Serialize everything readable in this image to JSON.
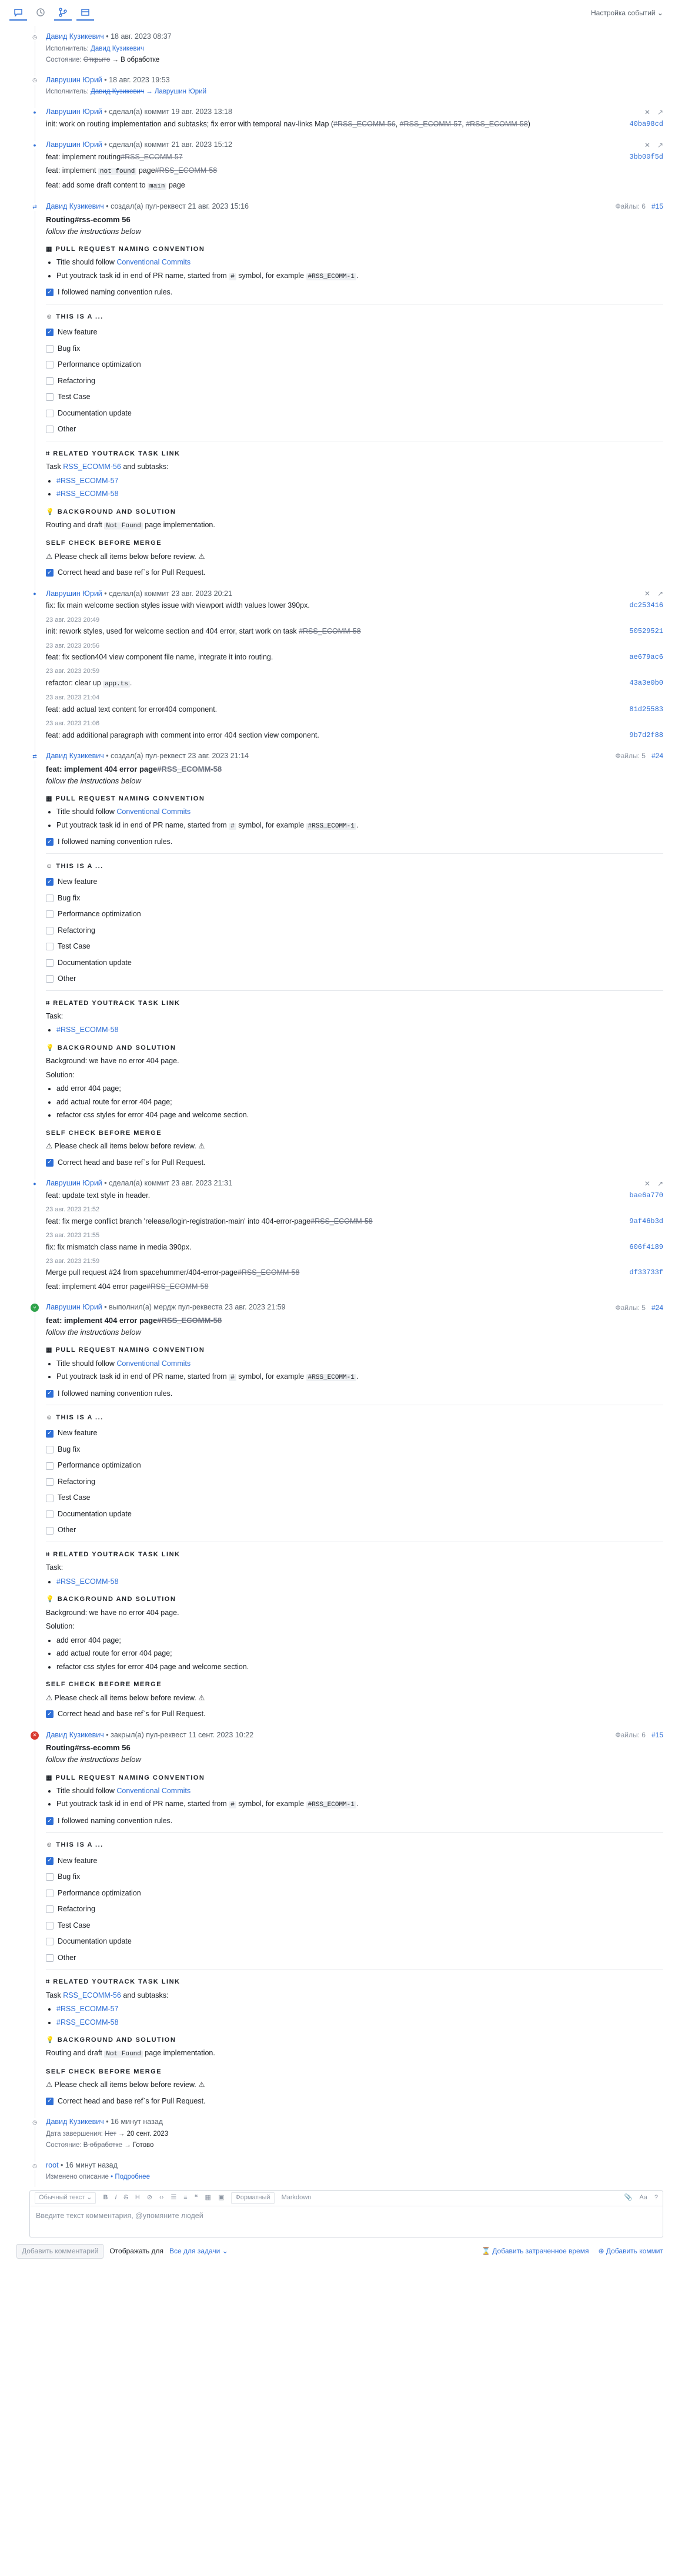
{
  "toolbar": {
    "settings": "Настройка событий ⌄"
  },
  "e1": {
    "author": "Давид Кузикевич",
    "date": "• 18 авг. 2023 08:37",
    "assignee_label": "Исполнитель:",
    "assignee": "Давид Кузикевич",
    "state_label": "Состояние:",
    "state_old": "Открыто",
    "state_new": "→ В обработке"
  },
  "e2": {
    "author": "Лаврушин Юрий",
    "date": "• 18 авг. 2023 19:53",
    "assignee_label": "Исполнитель:",
    "assignee_old": "Давид Кузикевич",
    "assignee_new": "→ Лаврушин Юрий"
  },
  "e3": {
    "author": "Лаврушин Юрий",
    "action": "• сделал(а) коммит 19 авг. 2023 13:18",
    "msg": "init: work on routing implementation and subtasks; fix error with temporal nav-links Map (",
    "s1": "#RSS_ECOMM-56",
    "s2": "#RSS_ECOMM-57",
    "s3": "#RSS_ECOMM-58",
    "end": ")",
    "hash": "40ba98cd"
  },
  "e4": {
    "author": "Лаврушин Юрий",
    "action": "• сделал(а) коммит 21 авг. 2023 15:12",
    "l1": "feat: implement routing",
    "l1s": "#RSS_ECOMM-57",
    "l2a": "feat: implement",
    "l2c": "not found",
    "l2b": "page",
    "l2s": "#RSS_ECOMM-58",
    "l3a": "feat: add some draft content to",
    "l3c": "main",
    "l3b": "page",
    "hash": "3bb00f5d"
  },
  "pr1": {
    "author": "Давид Кузикевич",
    "action": "• создал(а) пул-реквест 21 авг. 2023 15:16",
    "files": "Файлы: 6",
    "num": "#15",
    "title": "Routing#rss-ecomm 56",
    "sub": "follow the instructions below",
    "naming": "PULL REQUEST NAMING CONVENTION",
    "n1a": "Title should follow",
    "n1l": "Conventional Commits",
    "n2a": "Put youtrack task id in end of PR name, started from",
    "n2c": "#",
    "n2b": "symbol, for example",
    "n2c2": "#RSS_ECOMM-1",
    "n3": "I followed naming convention rules.",
    "this": "THIS IS A ...",
    "o": [
      "New feature",
      "Bug fix",
      "Performance optimization",
      "Refactoring",
      "Test Case",
      "Documentation update",
      "Other"
    ],
    "rel": "RELATED YOUTRACK TASK LINK",
    "task_a": "Task",
    "task_l": "RSS_ECOMM-56",
    "task_b": "and subtasks:",
    "sub1": "#RSS_ECOMM-57",
    "sub2": "#RSS_ECOMM-58",
    "bg": "BACKGROUND AND SOLUTION",
    "bg_a": "Routing and draft",
    "bg_c": "Not Found",
    "bg_b": "page implementation.",
    "self": "SELF CHECK BEFORE MERGE",
    "warn": "⚠ Please check all items below before review. ⚠",
    "sc1": "Correct head and base ref`s for Pull Request."
  },
  "e5": {
    "author": "Лаврушин Юрий",
    "action": "• сделал(а) коммит 23 авг. 2023 20:21",
    "c": [
      {
        "d": "",
        "m": "fix: fix main welcome section styles issue with viewport width values lower 390px.",
        "h": "dc253416"
      },
      {
        "d": "23 авг. 2023 20:49",
        "m": "init: rework styles, used for welcome section and 404 error, start work on task",
        "s": "#RSS_ECOMM-58",
        "h": "50529521"
      },
      {
        "d": "23 авг. 2023 20:56",
        "m": "feat: fix section404 view component file name, integrate it into routing.",
        "h": "ae679ac6"
      },
      {
        "d": "23 авг. 2023 20:59",
        "m": "refactor: clear up",
        "code": "app.ts",
        "h": "43a3e0b0"
      },
      {
        "d": "23 авг. 2023 21:04",
        "m": "feat: add actual text content for error404 component.",
        "h": "81d25583"
      },
      {
        "d": "23 авг. 2023 21:06",
        "m": "feat: add additional paragraph with comment into error 404 section view component.",
        "h": "9b7d2f88"
      }
    ]
  },
  "pr2": {
    "author": "Давид Кузикевич",
    "action": "• создал(а) пул-реквест 23 авг. 2023 21:14",
    "files": "Файлы: 5",
    "num": "#24",
    "title": "feat: implement 404 error page",
    "title_s": "#RSS_ECOMM-58",
    "sub": "follow the instructions below",
    "task": "Task:",
    "task_l": "#RSS_ECOMM-58",
    "bg1": "Background: we have no error 404 page.",
    "bg2": "Solution:",
    "bl": [
      "add error 404 page;",
      "add actual route for error 404 page;",
      "refactor css styles for error 404 page and welcome section."
    ]
  },
  "e6": {
    "author": "Лаврушин Юрий",
    "action": "• сделал(а) коммит 23 авг. 2023 21:31",
    "c": [
      {
        "d": "",
        "m": "feat: update text style in header.",
        "h": "bae6a770"
      },
      {
        "d": "23 авг. 2023 21:52",
        "m": "feat: fix merge conflict branch 'release/login-registration-main' into 404-error-page",
        "s": "#RSS_ECOMM-58",
        "h": "9af46b3d"
      },
      {
        "d": "23 авг. 2023 21:55",
        "m": "fix: fix mismatch class name in media 390px.",
        "h": "606f4189"
      },
      {
        "d": "23 авг. 2023 21:59",
        "m": "Merge pull request #24 from spacehummer/404-error-page",
        "s": "#RSS_ECOMM-58",
        "m2": "feat: implement 404 error page",
        "s2": "#RSS_ECOMM-58",
        "h": "df33733f"
      }
    ]
  },
  "pr3": {
    "author": "Лаврушин Юрий",
    "action": "• выполнил(а) мердж пул-реквеста 23 авг. 2023 21:59",
    "files": "Файлы: 5",
    "num": "#24"
  },
  "pr4": {
    "author": "Давид Кузикевич",
    "action": "• закрыл(а) пул-реквест 11 сент. 2023 10:22",
    "files": "Файлы: 6",
    "num": "#15"
  },
  "e7": {
    "author": "Давид Кузикевич",
    "date": "• 16 минут назад",
    "due_label": "Дата завершения:",
    "due_old": "Нет",
    "due_new": "→ 20 сент. 2023",
    "state_label": "Состояние:",
    "state_old": "В обработке",
    "state_new": "→ Готово"
  },
  "e8": {
    "author": "root",
    "date": "• 16 минут назад",
    "label": "Изменено описание",
    "link": "• Подробнее"
  },
  "editor": {
    "style": "Обычный текст ⌄",
    "b": "B",
    "i": "I",
    "s": "S",
    "x": "X",
    "h": "H",
    "link": "⊘",
    "code": "‹›",
    "formatted": "Форматный",
    "markdown": "Markdown",
    "aa": "Aa",
    "placeholder": "Введите текст комментария, @упомяните людей"
  },
  "footer": {
    "add": "Добавить комментарий",
    "show_a": "Отображать для",
    "show_b": "Все для задачи ⌄",
    "time": "Добавить затраченное время",
    "comment": "Добавить коммит"
  }
}
